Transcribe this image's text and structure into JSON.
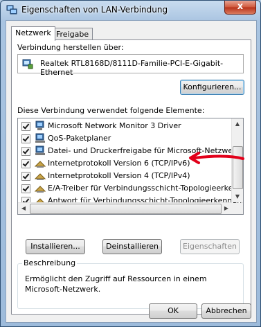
{
  "window": {
    "title": "Eigenschaften von LAN-Verbindung",
    "close_glyph": "x"
  },
  "tabs": [
    {
      "label": "Netzwerk",
      "active": true
    },
    {
      "label": "Freigabe",
      "active": false
    }
  ],
  "connect_via": {
    "label": "Verbindung herstellen über:",
    "adapter": "Realtek RTL8168D/8111D-Familie-PCI-E-Gigabit-Ethernet",
    "configure_button": "Konfigurieren..."
  },
  "components": {
    "label": "Diese Verbindung verwendet folgende Elemente:",
    "items": [
      {
        "label": "Microsoft Network Monitor 3 Driver",
        "checked": true,
        "icon": "network-client-icon"
      },
      {
        "label": "QoS-Paketplaner",
        "checked": true,
        "icon": "network-service-icon"
      },
      {
        "label": "Datei- und Druckerfreigabe für Microsoft-Netzwerke",
        "checked": true,
        "icon": "network-service-icon"
      },
      {
        "label": "Internetprotokoll Version 6 (TCP/IPv6)",
        "checked": true,
        "icon": "protocol-icon"
      },
      {
        "label": "Internetprotokoll Version 4 (TCP/IPv4)",
        "checked": true,
        "icon": "protocol-icon"
      },
      {
        "label": "E/A-Treiber für Verbindungsschicht-Topologieerkennung",
        "checked": true,
        "icon": "protocol-icon"
      },
      {
        "label": "Antwort für Verbindungsschicht-Topologieerkennung",
        "checked": true,
        "icon": "protocol-icon"
      }
    ]
  },
  "buttons": {
    "install": "Installieren...",
    "uninstall": "Deinstallieren",
    "properties": "Eigenschaften",
    "ok": "OK",
    "cancel": "Abbrechen"
  },
  "description": {
    "legend": "Beschreibung",
    "text": "Ermöglicht den Zugriff auf Ressourcen in einem Microsoft-Netzwerk."
  },
  "annotation": {
    "color": "#e2001a"
  }
}
